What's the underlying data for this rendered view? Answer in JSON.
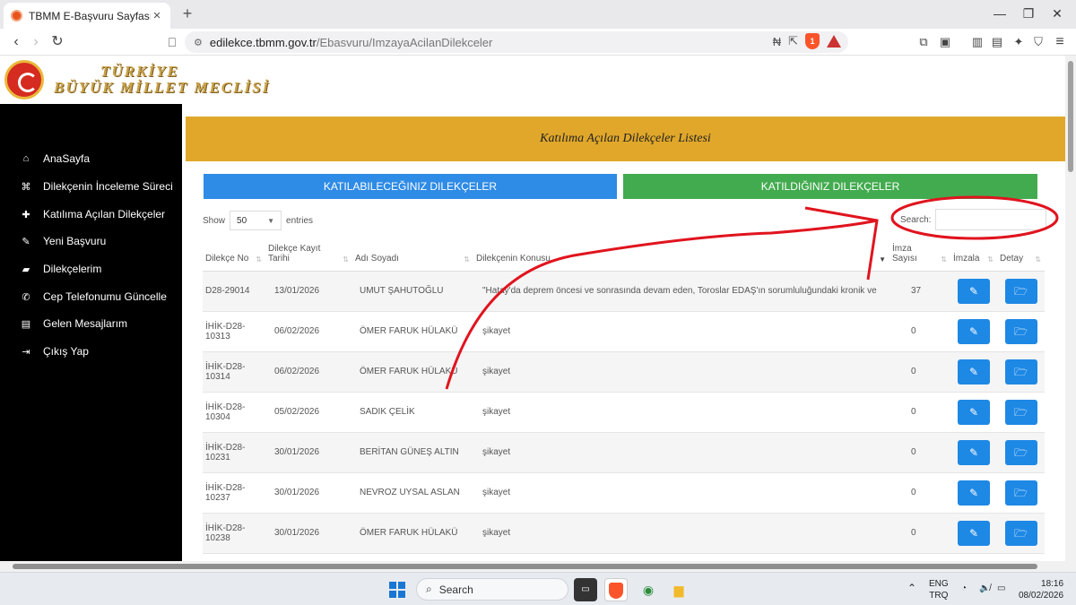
{
  "browser": {
    "tab_title": "TBMM E-Başvuru Sayfası",
    "url_host": "edilekce.tbmm.gov.tr",
    "url_path": "/Ebasvuru/ImzayaAcilanDilekceler",
    "window_controls": [
      "—",
      "❐",
      "✕"
    ],
    "brave_badge": "1"
  },
  "header": {
    "brand_line1": "TÜRKİYE",
    "brand_line2": "BÜYÜK MİLLET MECLİSİ"
  },
  "sidebar": {
    "items": [
      {
        "label": "AnaSayfa",
        "icon": "home-icon"
      },
      {
        "label": "Dilekçenin İnceleme Süreci",
        "icon": "institution-icon"
      },
      {
        "label": "Katılıma Açılan Dilekçeler",
        "icon": "user-plus-icon"
      },
      {
        "label": "Yeni Başvuru",
        "icon": "pencil-icon"
      },
      {
        "label": "Dilekçelerim",
        "icon": "folder-icon"
      },
      {
        "label": "Cep Telefonumu Güncelle",
        "icon": "phone-icon"
      },
      {
        "label": "Gelen Mesajlarım",
        "icon": "inbox-icon"
      },
      {
        "label": "Çıkış Yap",
        "icon": "sign-out-icon"
      }
    ]
  },
  "main": {
    "title": "Katılıma Açılan Dilekçeler Listesi",
    "tab_available": "KATILABILECEĞINIZ DILEKÇELER",
    "tab_joined": "KATILDIĞINIZ DILEKÇELER",
    "show_label": "Show",
    "entries_value": "50",
    "entries_label": "entries",
    "search_label": "Search:",
    "search_value": "",
    "columns": {
      "no": "Dilekçe No",
      "tarih_1": "Dilekçe Kayıt",
      "tarih_2": "Tarihi",
      "ad": "Adı Soyadı",
      "konu": "Dilekçenin Konusu",
      "imza_1": "İmza",
      "imza_2": "Sayısı",
      "imzala": "İmzala",
      "detay": "Detay"
    },
    "rows": [
      {
        "no1": "D28-29014",
        "no2": "",
        "date": "13/01/2026",
        "name": "UMUT ŞAHUTOĞLU",
        "subject": "\"Hatay'da deprem öncesi ve sonrasında devam eden, Toroslar EDAŞ'ın sorumluluğundaki kronik ve bilinç...",
        "count": "37"
      },
      {
        "no1": "İHİK-D28-",
        "no2": "10313",
        "date": "06/02/2026",
        "name": "ÖMER FARUK HÜLAKÜ",
        "subject": "şikayet",
        "count": "0"
      },
      {
        "no1": "İHİK-D28-",
        "no2": "10314",
        "date": "06/02/2026",
        "name": "ÖMER FARUK HÜLAKÜ",
        "subject": "şikayet",
        "count": "0"
      },
      {
        "no1": "İHİK-D28-",
        "no2": "10304",
        "date": "05/02/2026",
        "name": "SADIK ÇELİK",
        "subject": "şikayet",
        "count": "0"
      },
      {
        "no1": "İHİK-D28-",
        "no2": "10231",
        "date": "30/01/2026",
        "name": "BERİTAN GÜNEŞ ALTIN",
        "subject": "şikayet",
        "count": "0"
      },
      {
        "no1": "İHİK-D28-",
        "no2": "10237",
        "date": "30/01/2026",
        "name": "NEVROZ UYSAL ASLAN",
        "subject": "şikayet",
        "count": "0"
      },
      {
        "no1": "İHİK-D28-",
        "no2": "10238",
        "date": "30/01/2026",
        "name": "ÖMER FARUK HÜLAKÜ",
        "subject": "şikayet",
        "count": "0"
      }
    ]
  },
  "taskbar": {
    "search_placeholder": "Search",
    "lang_1": "ENG",
    "lang_2": "TRQ",
    "time": "18:16",
    "date": "08/02/2026"
  },
  "colors": {
    "title_bar": "#e0a72a",
    "tab_blue": "#2e8be6",
    "tab_green": "#43ab4f",
    "action_button": "#1e88e5",
    "annotation_red": "#e0141e"
  }
}
